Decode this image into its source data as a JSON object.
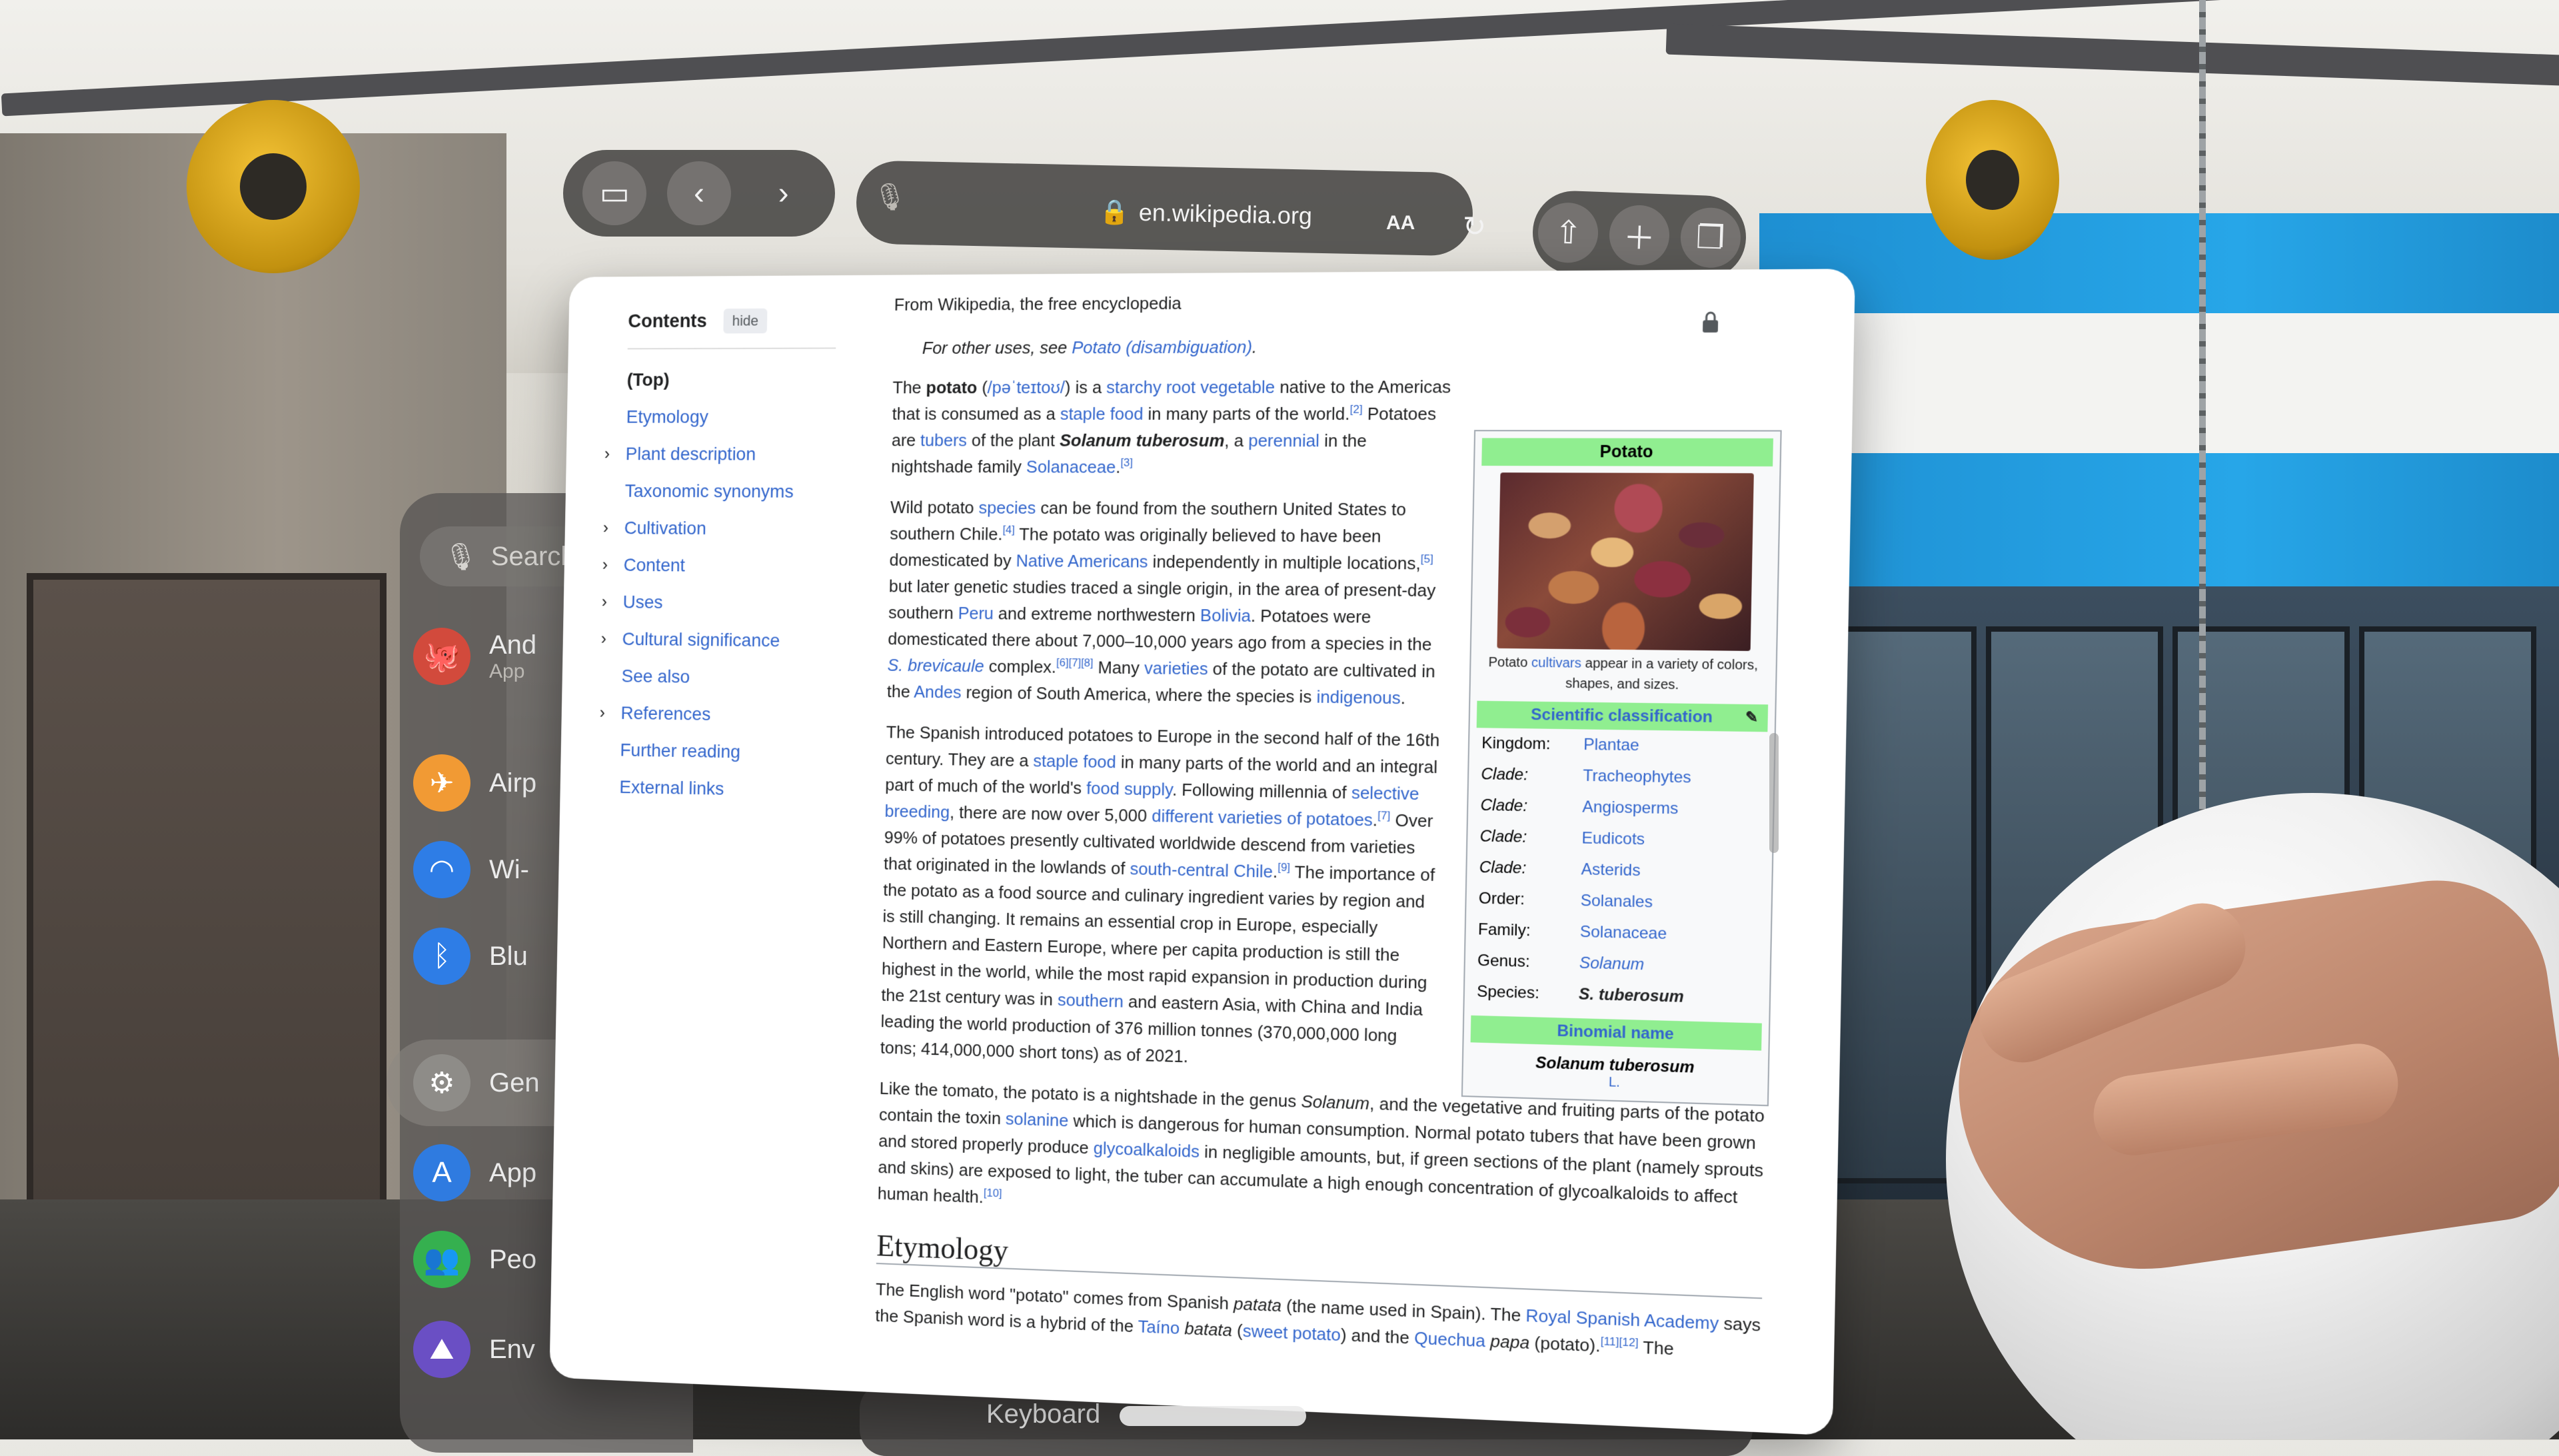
{
  "browser": {
    "url": "en.wikipedia.org",
    "aa_label": "AA",
    "keyboard_label": "Keyboard"
  },
  "settings_panel": {
    "search_placeholder": "Search",
    "items": [
      {
        "label": "And",
        "sub": "App"
      },
      {
        "label": "Airp"
      },
      {
        "label": "Wi-"
      },
      {
        "label": "Blu"
      },
      {
        "label": "Gen"
      },
      {
        "label": "App"
      },
      {
        "label": "Peo"
      },
      {
        "label": "Env"
      }
    ]
  },
  "toc": {
    "title": "Contents",
    "hide_label": "hide",
    "items": [
      {
        "label": "(Top)",
        "expandable": false
      },
      {
        "label": "Etymology",
        "expandable": false
      },
      {
        "label": "Plant description",
        "expandable": true
      },
      {
        "label": "Taxonomic synonyms",
        "expandable": false
      },
      {
        "label": "Cultivation",
        "expandable": true
      },
      {
        "label": "Content",
        "expandable": true
      },
      {
        "label": "Uses",
        "expandable": true
      },
      {
        "label": "Cultural significance",
        "expandable": true
      },
      {
        "label": "See also",
        "expandable": false
      },
      {
        "label": "References",
        "expandable": true
      },
      {
        "label": "Further reading",
        "expandable": false
      },
      {
        "label": "External links",
        "expandable": false
      }
    ]
  },
  "article": {
    "tagline": "From Wikipedia, the free encyclopedia",
    "hatnote_prefix": "For other uses, see ",
    "hatnote_link": "Potato (disambiguation)",
    "hatnote_suffix": ".",
    "p1": {
      "a": "The ",
      "b": "potato",
      "c": " (",
      "d": "/pəˈteɪtoʊ/",
      "e": ") is a ",
      "f": "starchy root vegetable",
      "g": " native to the Americas that is consumed as a ",
      "h": "staple food",
      "i": " in many parts of the world.",
      "j": "[2]",
      "k": " Potatoes are ",
      "l": "tubers",
      "m": " of the plant ",
      "n": "Solanum tuberosum",
      "o": ", a ",
      "p": "perennial",
      "q": " in the nightshade family ",
      "r": "Solanaceae",
      "s": ".",
      "t": "[3]"
    },
    "p2": {
      "a": "Wild potato ",
      "b": "species",
      "c": " can be found from the southern United States to southern Chile.",
      "d": "[4]",
      "e": " The potato was originally believed to have been domesticated by ",
      "f": "Native Americans",
      "g": " independently in multiple locations,",
      "h": "[5]",
      "i": " but later genetic studies traced a single origin, in the area of present-day southern ",
      "j": "Peru",
      "k": " and extreme northwestern ",
      "l": "Bolivia",
      "m": ". Potatoes were domesticated there about 7,000–10,000 years ago from a species in the ",
      "n": "S. brevicaule",
      "o": " complex.",
      "p": "[6][7][8]",
      "q": " Many ",
      "r": "varieties",
      "s": " of the potato are cultivated in the ",
      "t": "Andes",
      "u": " region of South America, where the species is ",
      "v": "indigenous",
      "w": "."
    },
    "p3": {
      "a": "The Spanish introduced potatoes to Europe in the second half of the 16th century. They are a ",
      "b": "staple food",
      "c": " in many parts of the world and an integral part of much of the world's ",
      "d": "food supply",
      "e": ". Following millennia of ",
      "f": "selective breeding",
      "g": ", there are now over 5,000 ",
      "h": "different varieties of potatoes",
      "i": ".",
      "j": "[7]",
      "k": " Over 99% of potatoes presently cultivated worldwide descend from varieties that originated in the lowlands of ",
      "l": "south-central Chile",
      "m": ".",
      "n": "[9]",
      "o": " The importance of the potato as a food source and culinary ingredient varies by region and is still changing. It remains an essential crop in Europe, especially Northern and Eastern Europe, where per capita production is still the highest in the world, while the most rapid expansion in production during the 21st century was in ",
      "p": "southern",
      "q": " and eastern Asia, with China and India leading the world production of 376 million tonnes (370,000,000 long tons; 414,000,000 short tons) as of 2021."
    },
    "p4": {
      "a": "Like the tomato, the potato is a nightshade in the genus ",
      "b": "Solanum",
      "c": ", and the vegetative and fruiting parts of the potato contain the toxin ",
      "d": "solanine",
      "e": " which is dangerous for human consumption. Normal potato tubers that have been grown and stored properly produce ",
      "f": "glycoalkaloids",
      "g": " in negligible amounts, but, if green sections of the plant (namely sprouts and skins) are exposed to light, the tuber can accumulate a high enough concentration of glycoalkaloids to affect human health.",
      "h": "[10]"
    },
    "etymology_heading": "Etymology",
    "p5": {
      "a": "The English word \"potato\" comes from Spanish ",
      "b": "patata",
      "c": " (the name used in Spain). The ",
      "d": "Royal Spanish Academy",
      "e": " says the Spanish word is a hybrid of the ",
      "f": "Taíno",
      "g": " ",
      "h": "batata",
      "i": " (",
      "j": "sweet potato",
      "k": ") and the ",
      "l": "Quechua",
      "m": " ",
      "n": "papa",
      "o": " (potato).",
      "p": "[11][12]",
      "q": " The"
    }
  },
  "infobox": {
    "title": "Potato",
    "caption_a": "Potato ",
    "caption_link": "cultivars",
    "caption_b": " appear in a variety of colors, shapes, and sizes.",
    "classification_title": "Scientific classification",
    "rows": [
      {
        "key": "Kingdom:",
        "value": "Plantae"
      },
      {
        "key": "Clade:",
        "value": "Tracheophytes"
      },
      {
        "key": "Clade:",
        "value": "Angiosperms"
      },
      {
        "key": "Clade:",
        "value": "Eudicots"
      },
      {
        "key": "Clade:",
        "value": "Asterids"
      },
      {
        "key": "Order:",
        "value": "Solanales"
      },
      {
        "key": "Family:",
        "value": "Solanaceae"
      },
      {
        "key": "Genus:",
        "value": "Solanum"
      },
      {
        "key": "Species:",
        "value": "S. tuberosum"
      }
    ],
    "binomial_title": "Binomial name",
    "binomial": "Solanum tuberosum",
    "authority": "L."
  },
  "colors": {
    "link": "#3366cc",
    "infobox_header": "#90ee90",
    "toolbar": "#464442"
  }
}
